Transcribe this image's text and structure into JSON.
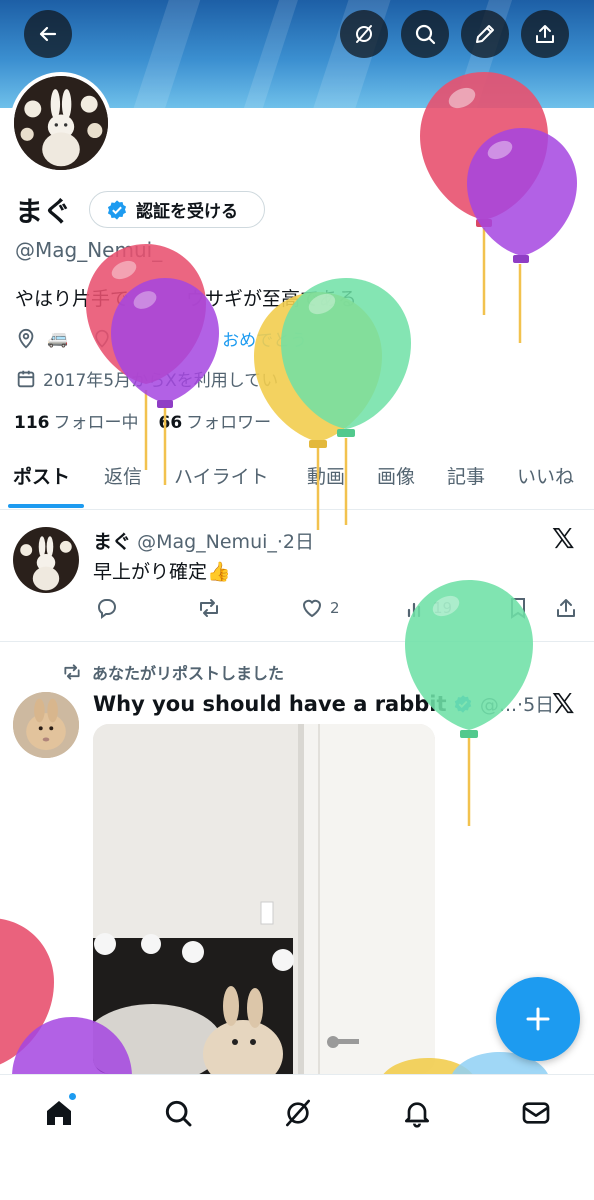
{
  "header": {
    "back_icon": "back-arrow-icon",
    "actions": [
      "grok-icon",
      "search-icon",
      "edit-icon",
      "share-icon"
    ]
  },
  "profile": {
    "name": "まぐ",
    "verify_label": "認証を受ける",
    "handle": "@Mag_Nemui_",
    "bio": "やはり片手で　　　ウサギが至高である",
    "location_emoji": "🚐",
    "link_text": "おめでとう",
    "joined": "2017年5月からXを利用してい",
    "following_count": "116",
    "following_label": "フォロー中",
    "followers_count": "66",
    "followers_label": "フォロワー"
  },
  "tabs": [
    "ポスト",
    "返信",
    "ハイライト",
    "動画",
    "画像",
    "記事",
    "いいね"
  ],
  "posts": [
    {
      "name": "まぐ",
      "handle": "@Mag_Nemui_",
      "time": "·2日",
      "text": "早上がり確定👍",
      "likes": "2",
      "views": "19"
    },
    {
      "repost_label": "あなたがリポストしました",
      "title": "Why you should have a rabbit",
      "handle": "@...",
      "time": "·5日"
    }
  ],
  "colors": {
    "accent": "#1d9bf0",
    "balloon_red": "#e8516f",
    "balloon_purple": "#a545e0",
    "balloon_green": "#6ee0a6",
    "balloon_yellow": "#f2cd4f"
  },
  "bottom_nav": [
    "home-icon",
    "search-icon",
    "grok-icon",
    "notifications-icon",
    "messages-icon"
  ]
}
